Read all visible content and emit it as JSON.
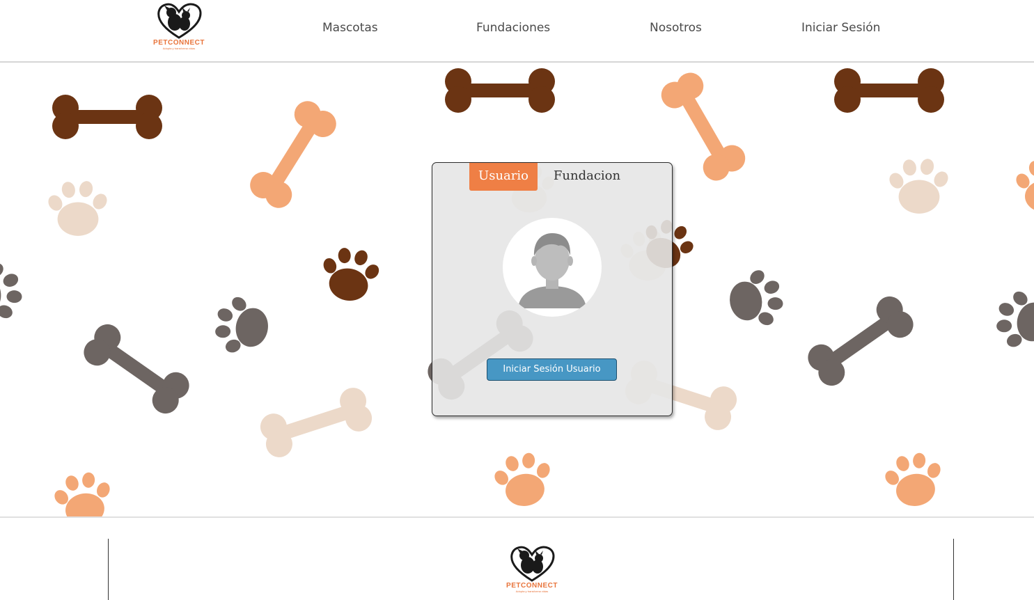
{
  "header": {
    "logo": {
      "brand": "PETCONNECT",
      "tagline": "Adopta y transforma vidas"
    },
    "nav": [
      {
        "label": "Mascotas"
      },
      {
        "label": "Fundaciones"
      },
      {
        "label": "Nosotros"
      },
      {
        "label": "Iniciar Sesión"
      }
    ]
  },
  "login_card": {
    "tabs": [
      {
        "label": "Usuario",
        "active": true
      },
      {
        "label": "Fundacion",
        "active": false
      }
    ],
    "avatar_icon": "user-avatar-icon",
    "button_label": "Iniciar Sesión Usuario"
  },
  "footer": {
    "logo": {
      "brand": "PETCONNECT",
      "tagline": "Adopta y transforma vidas"
    }
  },
  "colors": {
    "accent_orange": "#ef7f45",
    "button_blue": "#4797c4",
    "bone_dark_brown": "#6b3413",
    "bone_orange": "#f3a775",
    "bone_gray": "#6d6562",
    "bone_beige": "#ecd9c9"
  }
}
